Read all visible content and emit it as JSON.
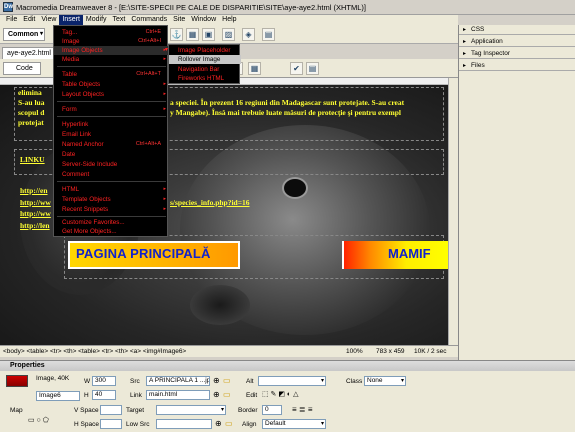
{
  "window": {
    "title": "Macromedia Dreamweaver 8 - [E:\\SITE-SPECII PE CALE DE DISPARITIE\\SITE\\aye-aye2.html (XHTML)]"
  },
  "menubar": [
    "File",
    "Edit",
    "View",
    "Insert",
    "Modify",
    "Text",
    "Commands",
    "Site",
    "Window",
    "Help"
  ],
  "toolbar": {
    "category": "Common"
  },
  "document": {
    "tab": "aye-aye2.html",
    "code_button": "Code"
  },
  "insert_menu": {
    "items": [
      {
        "label": "Tag...",
        "shortcut": "Ctrl+E"
      },
      {
        "label": "Image",
        "shortcut": "Ctrl+Alt+I"
      },
      {
        "label": "Image Objects",
        "arrow": "▸"
      },
      {
        "label": "Media",
        "arrow": "▸"
      },
      {
        "label": "Table",
        "shortcut": "Ctrl+Alt+T"
      },
      {
        "label": "Table Objects",
        "arrow": "▸"
      },
      {
        "label": "Layout Objects",
        "arrow": "▸"
      },
      {
        "label": "Form",
        "arrow": "▸"
      },
      {
        "label": "Hyperlink"
      },
      {
        "label": "Email Link"
      },
      {
        "label": "Named Anchor",
        "shortcut": "Ctrl+Alt+A"
      },
      {
        "label": "Date"
      },
      {
        "label": "Server-Side Include"
      },
      {
        "label": "Comment"
      },
      {
        "label": "HTML",
        "arrow": "▸"
      },
      {
        "label": "Template Objects",
        "arrow": "▸"
      },
      {
        "label": "Recent Snippets",
        "arrow": "▸"
      },
      {
        "label": "Customize Favorites..."
      },
      {
        "label": "Get More Objects..."
      }
    ],
    "submenu": [
      "Image Placeholder",
      "Rollover Image",
      "Navigation Bar",
      "Fireworks HTML"
    ]
  },
  "page": {
    "line1": "elimina",
    "line2a": "S-au lua",
    "line2b": "a speciei. În prezent 16 regiuni din Madagascar sunt protejate. S-au creat",
    "line3a": "scopul d",
    "line3b": "y Mangabe).  Însă mai trebuie luate măsuri de protecţie şi pentru exempl",
    "line4": "protejat",
    "links_heading": "LINKU",
    "link1": "http://en",
    "link2": "http://ww",
    "link2b": "s/species_info.php?id=16",
    "link3": "http://ww",
    "link4": "http://len",
    "button1": "PAGINA PRINCIPALĂ",
    "button2": "MAMIF"
  },
  "status": {
    "tags": "<body> <table> <tr> <th> <table> <tr> <th> <a> <img#Image6>",
    "zoom": "100%",
    "size": "783 x 459",
    "download": "10K / 2 sec"
  },
  "panels": [
    "CSS",
    "Application",
    "Tag Inspector",
    "Files"
  ],
  "properties": {
    "title": "Properties",
    "type": "Image, 40K",
    "name": "Image6",
    "w_label": "W",
    "w": "300",
    "h_label": "H",
    "h": "40",
    "src_label": "Src",
    "src": "A PRINCIPALA 1 ...jpg",
    "link_label": "Link",
    "link": "main.html",
    "alt_label": "Alt",
    "alt": "",
    "edit_label": "Edit",
    "class_label": "Class",
    "class": "None",
    "map_label": "Map",
    "vspace_label": "V Space",
    "hspace_label": "H Space",
    "target_label": "Target",
    "lowsrc_label": "Low Src",
    "border_label": "Border",
    "border": "0",
    "align_label": "Align",
    "align": "Default"
  }
}
